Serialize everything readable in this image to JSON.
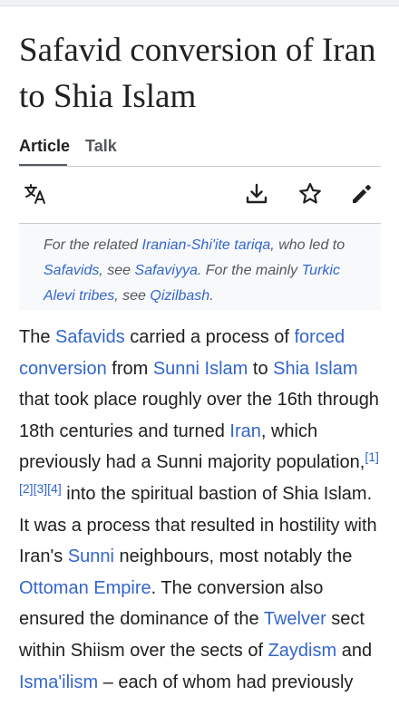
{
  "article": {
    "title": "Safavid conversion of Iran to Shia Islam"
  },
  "tabs": [
    {
      "label": "Article",
      "active": true
    },
    {
      "label": "Talk",
      "active": false
    }
  ],
  "toolbar": {
    "icons": [
      "translate-icon",
      "download-icon",
      "star-icon",
      "edit-pencil-icon"
    ]
  },
  "hatnote": {
    "t1": "For the related ",
    "link1": "Iranian-Shi'ite tariqa",
    "t2": ", who led to ",
    "link2": "Safavids",
    "t3": ", see ",
    "link3": "Safaviyya",
    "t4": ". For the mainly ",
    "link4": "Turkic Alevi tribes",
    "t5": ", see ",
    "link5": "Qizilbash",
    "t6": "."
  },
  "body": {
    "t1": "The ",
    "link_safavids": "Safavids",
    "t2": " carried a process of ",
    "link_forced_conversion": "forced conversion",
    "t3": " from ",
    "link_sunni_islam": "Sunni Islam",
    "t4": " to ",
    "link_shia_islam": "Shia Islam",
    "t5": " that took place roughly over the 16th through 18th centuries and turned ",
    "link_iran": "Iran",
    "t6": ", which previously had a Sunni majority population,",
    "ref1": "[1]",
    "ref2": "[2]",
    "ref3": "[3]",
    "ref4": "[4]",
    "t7": " into the spiritual bastion of Shia Islam. It was a process that resulted in hostility with Iran's ",
    "link_sunni": "Sunni",
    "t8": " neighbours, most notably the ",
    "link_ottoman": "Ottoman Empire",
    "t9": ". The conversion also ensured the dominance of the ",
    "link_twelver": "Twelver",
    "t10": " sect within Shiism over the sects of ",
    "link_zaydism": "Zaydism",
    "t11": " and ",
    "link_ismailism": "Isma'ilism",
    "t12": " – each of whom had previously"
  },
  "colors": {
    "link": "#3366cc",
    "text": "#202122",
    "muted": "#54595d",
    "hatnote_bg": "#f8f9fa",
    "rule": "#c8ccd1"
  }
}
